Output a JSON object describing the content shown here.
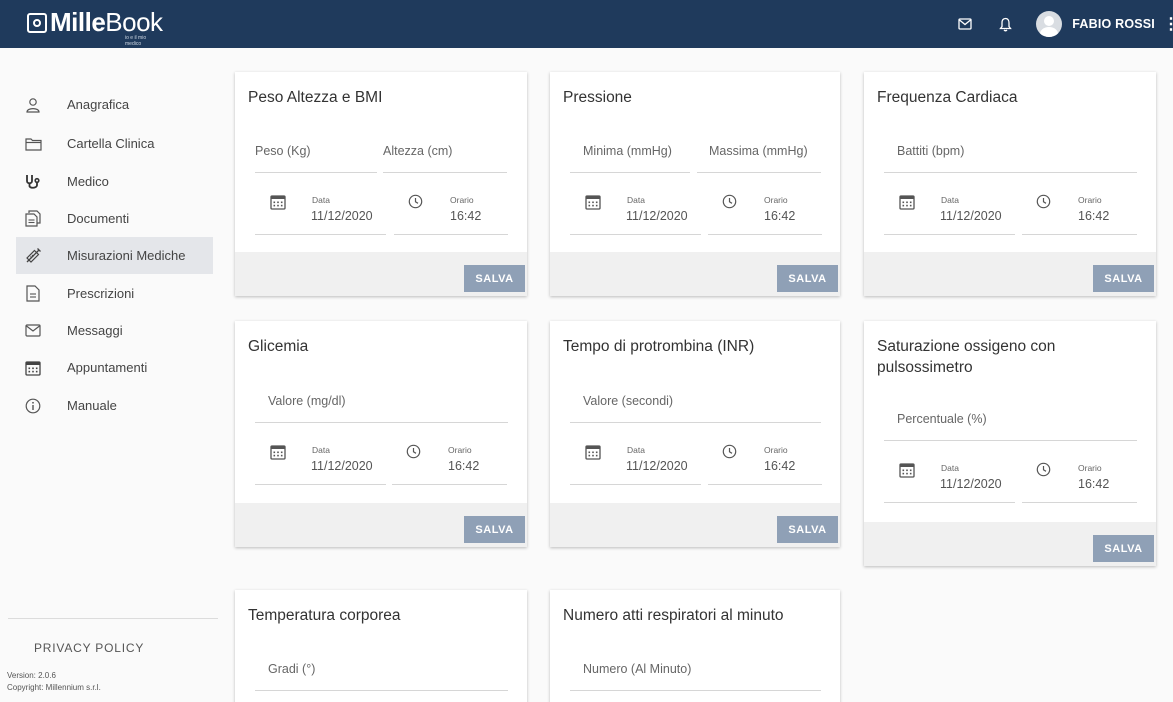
{
  "header": {
    "logo_bold": "Mille",
    "logo_light": "Book",
    "logo_tagline": "io e il mio medico",
    "user_name": "FABIO ROSSI",
    "icons": [
      "mail-icon",
      "bell-icon",
      "avatar",
      "more-vert-icon"
    ]
  },
  "sidebar": {
    "items": [
      {
        "label": "Anagrafica",
        "icon": "person-icon"
      },
      {
        "label": "Cartella Clinica",
        "icon": "folder-icon"
      },
      {
        "label": "Medico",
        "icon": "stethoscope-icon"
      },
      {
        "label": "Documenti",
        "icon": "documents-icon"
      },
      {
        "label": "Misurazioni Mediche",
        "icon": "syringe-icon",
        "active": true
      },
      {
        "label": "Prescrizioni",
        "icon": "prescription-icon"
      },
      {
        "label": "Messaggi",
        "icon": "mail-icon"
      },
      {
        "label": "Appuntamenti",
        "icon": "calendar-icon"
      },
      {
        "label": "Manuale",
        "icon": "info-icon"
      }
    ],
    "privacy": "PRIVACY POLICY",
    "version": "Version: 2.0.6",
    "copyright": "Copyright: Millennium s.r.l."
  },
  "common": {
    "date_label": "Data",
    "date_value": "11/12/2020",
    "time_label": "Orario",
    "time_value": "16:42",
    "save_label": "SALVA"
  },
  "cards": [
    {
      "title": "Peso Altezza e BMI",
      "fields": [
        "Peso (Kg)",
        "Altezza (cm)"
      ]
    },
    {
      "title": "Pressione",
      "fields": [
        "Minima (mmHg)",
        "Massima (mmHg)"
      ]
    },
    {
      "title": "Frequenza Cardiaca",
      "fields": [
        "Battiti (bpm)"
      ]
    },
    {
      "title": "Glicemia",
      "fields": [
        "Valore (mg/dl)"
      ]
    },
    {
      "title": "Tempo di protrombina (INR)",
      "fields": [
        "Valore (secondi)"
      ]
    },
    {
      "title_line1": "Saturazione ossigeno con",
      "title_line2": "pulsossimetro",
      "fields": [
        "Percentuale (%)"
      ]
    },
    {
      "title": "Temperatura corporea",
      "fields": [
        "Gradi (°)"
      ]
    },
    {
      "title": "Numero atti respiratori al minuto",
      "fields": [
        "Numero (Al Minuto)"
      ]
    }
  ]
}
